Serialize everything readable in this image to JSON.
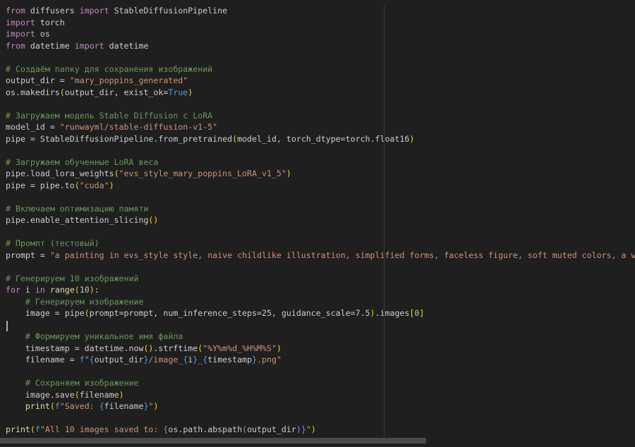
{
  "editor": {
    "lines": [
      [
        [
          "t-kw",
          "from"
        ],
        [
          "t-plain",
          " diffusers "
        ],
        [
          "t-kw",
          "import"
        ],
        [
          "t-plain",
          " StableDiffusionPipeline"
        ]
      ],
      [
        [
          "t-kw",
          "import"
        ],
        [
          "t-plain",
          " torch"
        ]
      ],
      [
        [
          "t-kw",
          "import"
        ],
        [
          "t-plain",
          " os"
        ]
      ],
      [
        [
          "t-kw",
          "from"
        ],
        [
          "t-plain",
          " datetime "
        ],
        [
          "t-kw",
          "import"
        ],
        [
          "t-plain",
          " datetime"
        ]
      ],
      [],
      [
        [
          "t-cmt",
          "# Создаём папку для сохранения изображений"
        ]
      ],
      [
        [
          "t-plain",
          "output_dir = "
        ],
        [
          "t-str",
          "\"mary_poppins_generated\""
        ]
      ],
      [
        [
          "t-plain",
          "os.makedirs"
        ],
        [
          "t-p1",
          "("
        ],
        [
          "t-plain",
          "output_dir, exist_ok="
        ],
        [
          "t-const",
          "True"
        ],
        [
          "t-p1",
          ")"
        ]
      ],
      [],
      [
        [
          "t-cmt",
          "# Загружаем модель Stable Diffusion с LoRA"
        ]
      ],
      [
        [
          "t-plain",
          "model_id = "
        ],
        [
          "t-str",
          "\"runwayml/stable-diffusion-v1-5\""
        ]
      ],
      [
        [
          "t-plain",
          "pipe = StableDiffusionPipeline.from_pretrained"
        ],
        [
          "t-p1",
          "("
        ],
        [
          "t-plain",
          "model_id, torch_dtype=torch.float16"
        ],
        [
          "t-p1",
          ")"
        ]
      ],
      [],
      [
        [
          "t-cmt",
          "# Загружаем обученные LoRA веса"
        ]
      ],
      [
        [
          "t-plain",
          "pipe.load_lora_weights"
        ],
        [
          "t-p1",
          "("
        ],
        [
          "t-str",
          "\"evs_style_mary_poppins_LoRA_v1_5\""
        ],
        [
          "t-p1",
          ")"
        ]
      ],
      [
        [
          "t-plain",
          "pipe = pipe.to"
        ],
        [
          "t-p1",
          "("
        ],
        [
          "t-str",
          "\"cuda\""
        ],
        [
          "t-p1",
          ")"
        ]
      ],
      [],
      [
        [
          "t-cmt",
          "# Включаем оптимизацию памяти"
        ]
      ],
      [
        [
          "t-plain",
          "pipe.enable_attention_slicing"
        ],
        [
          "t-p1",
          "()"
        ]
      ],
      [],
      [
        [
          "t-cmt",
          "# Промпт (тестовый)"
        ]
      ],
      [
        [
          "t-plain",
          "prompt = "
        ],
        [
          "t-str",
          "\"a painting in evs_style style, naive childlike illustration, simplified forms, faceless figure, soft muted colors, a woman"
        ]
      ],
      [],
      [
        [
          "t-cmt",
          "# Генерируем 10 изображений"
        ]
      ],
      [
        [
          "t-kw",
          "for"
        ],
        [
          "t-plain",
          " i "
        ],
        [
          "t-kw",
          "in"
        ],
        [
          "t-plain",
          " "
        ],
        [
          "t-fn",
          "range"
        ],
        [
          "t-p1",
          "("
        ],
        [
          "t-num",
          "10"
        ],
        [
          "t-p1",
          ")"
        ],
        [
          "t-plain",
          ":"
        ]
      ],
      [
        [
          "t-plain",
          "    "
        ],
        [
          "t-cmt",
          "# Генерируем изображение"
        ]
      ],
      [
        [
          "t-plain",
          "    image = pipe"
        ],
        [
          "t-p1",
          "("
        ],
        [
          "t-plain",
          "prompt=prompt, num_inference_steps=25, guidance_scale=7.5"
        ],
        [
          "t-p1",
          ")"
        ],
        [
          "t-plain",
          ".images"
        ],
        [
          "t-p1",
          "["
        ],
        [
          "t-num",
          "0"
        ],
        [
          "t-p1",
          "]"
        ]
      ],
      [],
      [
        [
          "t-plain",
          "    "
        ],
        [
          "t-cmt",
          "# Формируем уникальное имя файла"
        ]
      ],
      [
        [
          "t-plain",
          "    timestamp = datetime.now"
        ],
        [
          "t-p1",
          "()"
        ],
        [
          "t-plain",
          ".strftime"
        ],
        [
          "t-p1",
          "("
        ],
        [
          "t-str",
          "\"%Y%m%d_%H%M%S\""
        ],
        [
          "t-p1",
          ")"
        ]
      ],
      [
        [
          "t-plain",
          "    filename = "
        ],
        [
          "t-const",
          "f"
        ],
        [
          "t-str",
          "\""
        ],
        [
          "t-const",
          "{"
        ],
        [
          "t-plain",
          "output_dir"
        ],
        [
          "t-const",
          "}"
        ],
        [
          "t-str",
          "/image_"
        ],
        [
          "t-const",
          "{"
        ],
        [
          "t-plain",
          "i"
        ],
        [
          "t-const",
          "}"
        ],
        [
          "t-str",
          "_"
        ],
        [
          "t-const",
          "{"
        ],
        [
          "t-plain",
          "timestamp"
        ],
        [
          "t-const",
          "}"
        ],
        [
          "t-str",
          ".png\""
        ]
      ],
      [],
      [
        [
          "t-plain",
          "    "
        ],
        [
          "t-cmt",
          "# Сохраняем изображение"
        ]
      ],
      [
        [
          "t-plain",
          "    image.save"
        ],
        [
          "t-p1",
          "("
        ],
        [
          "t-plain",
          "filename"
        ],
        [
          "t-p1",
          ")"
        ]
      ],
      [
        [
          "t-plain",
          "    "
        ],
        [
          "t-fn",
          "print"
        ],
        [
          "t-p1",
          "("
        ],
        [
          "t-const",
          "f"
        ],
        [
          "t-str",
          "\"Saved: "
        ],
        [
          "t-const",
          "{"
        ],
        [
          "t-plain",
          "filename"
        ],
        [
          "t-const",
          "}"
        ],
        [
          "t-str",
          "\""
        ],
        [
          "t-p1",
          ")"
        ]
      ],
      [],
      [
        [
          "t-fn",
          "print"
        ],
        [
          "t-p1",
          "("
        ],
        [
          "t-const",
          "f"
        ],
        [
          "t-str",
          "\"All 10 images saved to: "
        ],
        [
          "t-const",
          "{"
        ],
        [
          "t-plain",
          "os.path.abspath"
        ],
        [
          "t-p2",
          "("
        ],
        [
          "t-plain",
          "output_dir"
        ],
        [
          "t-p2",
          ")"
        ],
        [
          "t-const",
          "}"
        ],
        [
          "t-str",
          "\""
        ],
        [
          "t-p1",
          ")"
        ]
      ]
    ]
  }
}
